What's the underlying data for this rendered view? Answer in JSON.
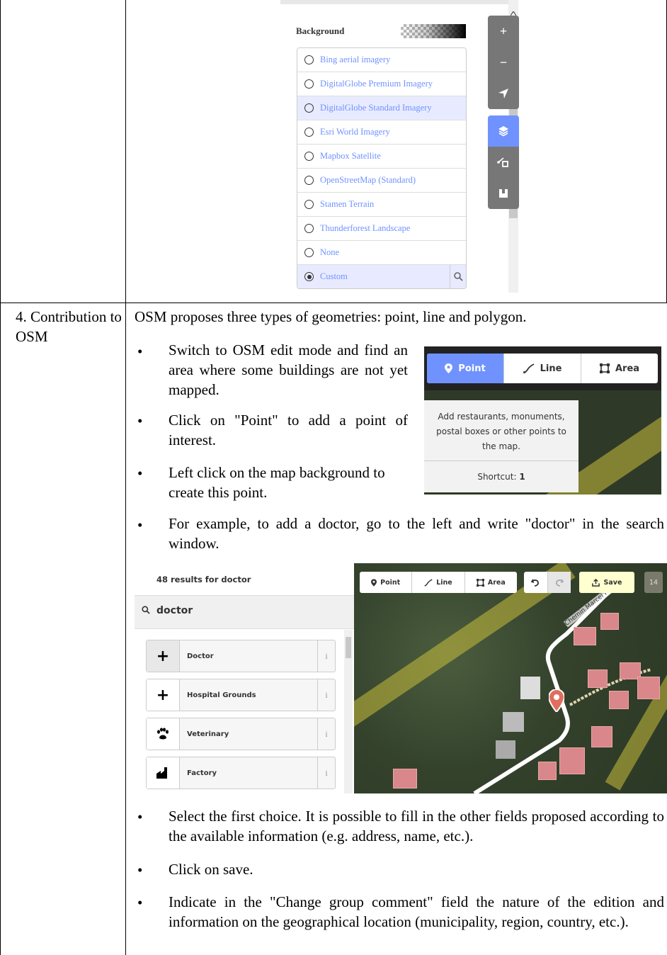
{
  "background_panel": {
    "title": "Background",
    "options": [
      {
        "label": "Bing aerial imagery",
        "selected": false
      },
      {
        "label": "DigitalGlobe Premium Imagery",
        "selected": false
      },
      {
        "label": "DigitalGlobe Standard Imagery",
        "selected": false
      },
      {
        "label": "Esri World Imagery",
        "selected": false
      },
      {
        "label": "Mapbox Satellite",
        "selected": false
      },
      {
        "label": "OpenStreetMap (Standard)",
        "selected": false
      },
      {
        "label": "Stamen Terrain",
        "selected": false
      },
      {
        "label": "Thunderforest Landscape",
        "selected": false
      },
      {
        "label": "None",
        "selected": false
      },
      {
        "label": "Custom",
        "selected": true
      }
    ],
    "controls": [
      "+",
      "−"
    ]
  },
  "row": {
    "label": "4. Contribution to OSM",
    "intro": "OSM proposes three types of geometries: point, line and polygon.",
    "bullets": [
      "Switch to OSM edit mode and find an area where some buildings are not yet mapped.",
      "Click on \"Point\" to add a point of interest.",
      "Left click on the map background to create this point.",
      "For example, to add a doctor, go to the left and write \"doctor\" in the search window.",
      "Select the first choice. It is possible to fill in the other fields proposed according to the available information (e.g. address, name, etc.).",
      "Click on save.",
      "Indicate in the \"Change group comment\" field the nature of the edition and information on the geographical location (municipality, region, country, etc.)."
    ]
  },
  "figure_modes": {
    "buttons": [
      "Point",
      "Line",
      "Area"
    ],
    "tooltip_text": "Add restaurants, monuments, postal boxes or other points to the map.",
    "shortcut_label": "Shortcut:",
    "shortcut_key": "1"
  },
  "figure_search": {
    "results_title": "48 results for doctor",
    "query": "doctor",
    "presets": [
      "Doctor",
      "Hospital Grounds",
      "Veterinary",
      "Factory"
    ],
    "info_glyph": "i",
    "toolbar": {
      "point": "Point",
      "line": "Line",
      "area": "Area",
      "save": "Save",
      "count": "14"
    },
    "street_name": "Chemin Marcel Hoarau"
  },
  "colors": {
    "accent": "#7092ff",
    "control_gray": "#777777",
    "tooltip_bg": "#f2f2f2"
  }
}
